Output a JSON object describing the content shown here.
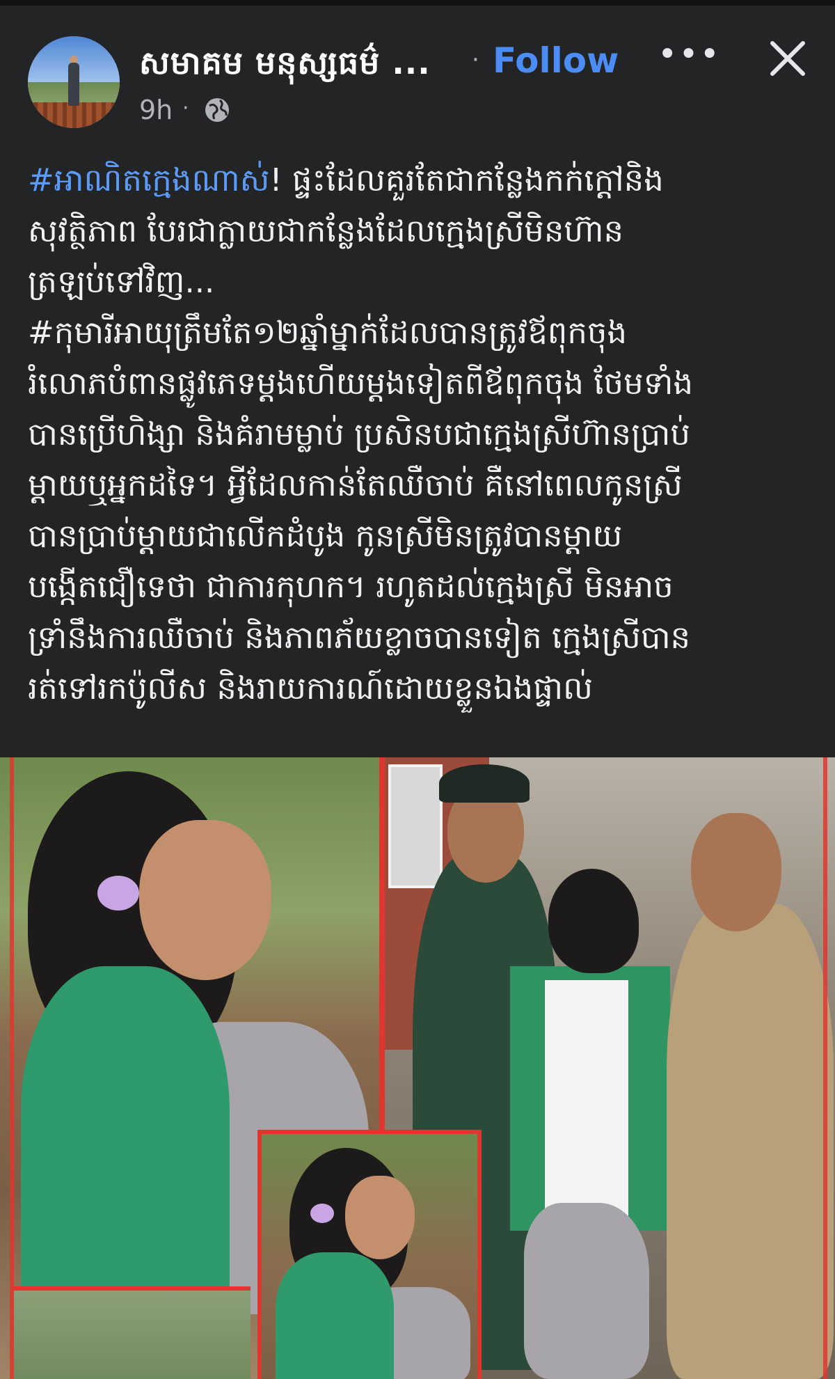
{
  "header": {
    "page_name": "សមាគម មនុស្សធម៌ ...",
    "separator": "·",
    "follow_label": "Follow",
    "more_label": "•••",
    "close_icon": "close-icon",
    "time": "9h",
    "time_separator": "·",
    "audience_icon": "globe-icon"
  },
  "post": {
    "lines": [
      {
        "hashtag": "#អាណិតក្មេងណាស់",
        "text": "! ផ្ទះដែលគួរតែជាកន្លែងកក់ក្ដៅនិង"
      },
      {
        "hashtag": "",
        "text": "សុវត្ថិភាព បែរជាក្លាយជាកន្លែងដែលក្មេងស្រីមិនហ៊ាន"
      },
      {
        "hashtag": "",
        "text": "ត្រឡប់ទៅវិញ..."
      },
      {
        "hashtag": "",
        "text": "#កុមារីអាយុត្រឹមតែ១២ឆ្នាំម្នាក់ដែលបានត្រូវឪពុកចុង"
      },
      {
        "hashtag": "",
        "text": "រំលោភបំពានផ្លូវភេទម្ដងហើយម្ដងទៀតពីឪពុកចុង ថែមទាំង"
      },
      {
        "hashtag": "",
        "text": "បានប្រើហិង្សា និងគំរាមម្លាប់ ប្រសិនបជាក្មេងស្រីហ៊ានប្រាប់"
      },
      {
        "hashtag": "",
        "text": "ម្ដាយឬអ្នកដទៃ។ អ្វីដែលកាន់តែឈឺចាប់ គឺនៅពេលកូនស្រី"
      },
      {
        "hashtag": "",
        "text": "បានប្រាប់ម្ដាយជាលើកដំបូង កូនស្រីមិនត្រូវបានម្ដាយ"
      },
      {
        "hashtag": "",
        "text": "បង្កើតជឿទេថា ជាការកុហក។ រហូតដល់ក្មេងស្រី មិនអាច"
      },
      {
        "hashtag": "",
        "text": "ទ្រាំនឹងការឈឺចាប់ និងភាពភ័យខ្លាចបានទៀត ក្មេងស្រីបាន"
      },
      {
        "hashtag": "",
        "text": "រត់ទៅរកប៉ូលីស និងរាយការណ៍ដោយខ្លួនឯងផ្ទាល់"
      }
    ]
  },
  "colors": {
    "background": "#232426",
    "link_blue": "#4b8cf5",
    "hashtag_blue": "#5b9bf7",
    "collage_border_red": "#e1362f"
  }
}
